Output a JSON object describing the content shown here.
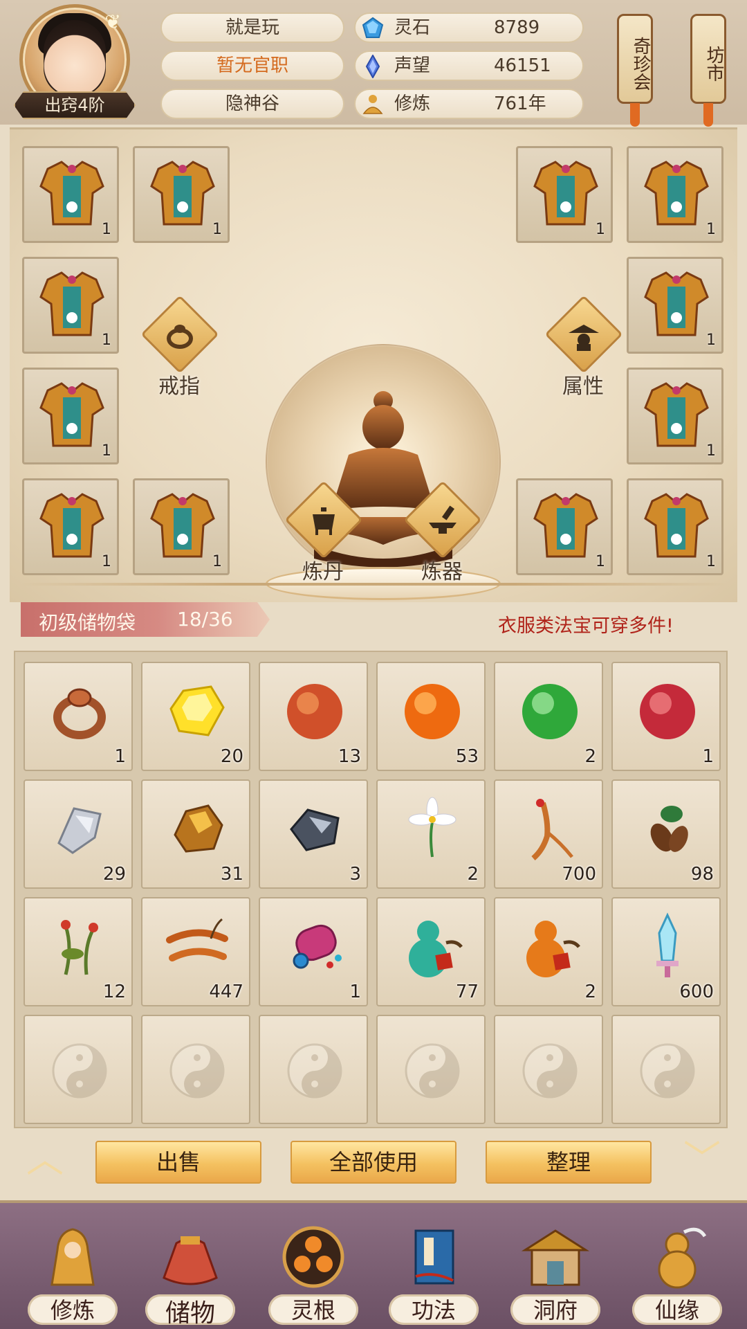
{
  "player": {
    "name": "就是玩",
    "title": "暂无官职",
    "sect": "隐神谷",
    "realm": "出窍4阶"
  },
  "stats": [
    {
      "label": "灵石",
      "value": "8789",
      "icon": "spirit-stone-icon",
      "color": "#3a9be0"
    },
    {
      "label": "声望",
      "value": "46151",
      "icon": "reputation-crystal-icon",
      "color": "#5a7de0"
    },
    {
      "label": "修炼",
      "value": "761年",
      "icon": "cultivation-icon",
      "color": "#e0a23a"
    }
  ],
  "hanging_signs": {
    "qizhen": "奇珍会",
    "fangshi": "坊市"
  },
  "equipment": {
    "slots": [
      {
        "item": "armor",
        "count": "1"
      },
      {
        "item": "armor",
        "count": "1"
      },
      {
        "item": "armor",
        "count": "1"
      },
      {
        "item": "armor",
        "count": "1"
      },
      {
        "item": "armor",
        "count": "1"
      },
      {
        "item": "armor",
        "count": "1"
      },
      {
        "item": "armor",
        "count": "1"
      },
      {
        "item": "armor",
        "count": "1"
      },
      {
        "item": "armor",
        "count": "1"
      },
      {
        "item": "armor",
        "count": "1"
      },
      {
        "item": "armor",
        "count": "1"
      },
      {
        "item": "armor",
        "count": "1"
      }
    ],
    "skills": {
      "ring": "戒指",
      "attributes": "属性",
      "alchemy": "炼丹",
      "forge": "炼器"
    }
  },
  "bag": {
    "name": "初级储物袋",
    "capacity": "18/36",
    "hint": "衣服类法宝可穿多件!"
  },
  "inventory": [
    {
      "icon": "ring-icon",
      "count": "1"
    },
    {
      "icon": "yellow-gem-icon",
      "count": "20"
    },
    {
      "icon": "red-orb-icon",
      "count": "13"
    },
    {
      "icon": "orange-orb-icon",
      "count": "53"
    },
    {
      "icon": "green-orb-icon",
      "count": "2"
    },
    {
      "icon": "crimson-orb-icon",
      "count": "1"
    },
    {
      "icon": "silver-ore-icon",
      "count": "29"
    },
    {
      "icon": "gold-ore-icon",
      "count": "31"
    },
    {
      "icon": "dark-ore-icon",
      "count": "3"
    },
    {
      "icon": "white-flower-icon",
      "count": "2"
    },
    {
      "icon": "ginseng-icon",
      "count": "700"
    },
    {
      "icon": "root-herb-icon",
      "count": "98"
    },
    {
      "icon": "red-flower-herb-icon",
      "count": "12"
    },
    {
      "icon": "cordyceps-icon",
      "count": "447"
    },
    {
      "icon": "scroll-artifact-icon",
      "count": "1"
    },
    {
      "icon": "green-gourd-icon",
      "count": "77"
    },
    {
      "icon": "orange-gourd-icon",
      "count": "2"
    },
    {
      "icon": "crystal-sword-icon",
      "count": "600"
    }
  ],
  "actions": {
    "sell": "出售",
    "use_all": "全部使用",
    "sort": "整理"
  },
  "nav": [
    {
      "label": "修炼",
      "icon": "monk-icon"
    },
    {
      "label": "储物",
      "icon": "storage-bag-icon"
    },
    {
      "label": "灵根",
      "icon": "spirit-root-icon"
    },
    {
      "label": "功法",
      "icon": "scripture-book-icon"
    },
    {
      "label": "洞府",
      "icon": "cave-dwelling-icon"
    },
    {
      "label": "仙缘",
      "icon": "gourd-fortune-icon"
    }
  ]
}
